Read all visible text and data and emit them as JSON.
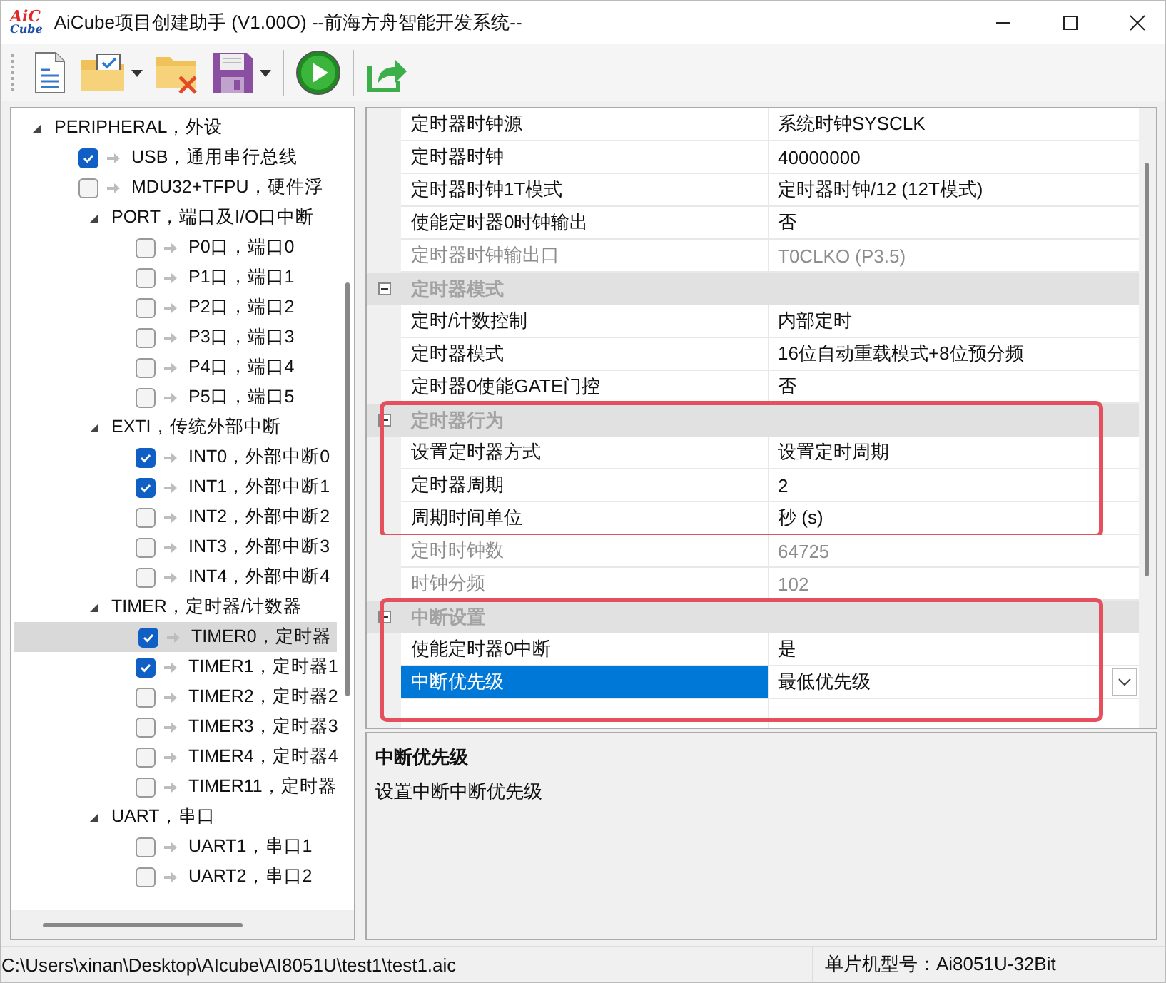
{
  "window": {
    "logo": {
      "top": "AiC",
      "bottom": "Cube"
    },
    "title": "AiCube项目创建助手 (V1.00O) --前海方舟智能开发系统--"
  },
  "tree": {
    "kind": "group",
    "label": "PERIPHERAL，外设",
    "expanded": true,
    "children": [
      {
        "kind": "item",
        "label": "USB，通用串行总线",
        "checked": true,
        "selected": false
      },
      {
        "kind": "item",
        "label": "MDU32+TFPU，硬件浮",
        "checked": false,
        "selected": false
      },
      {
        "kind": "group",
        "label": "PORT，端口及I/O口中断",
        "expanded": true,
        "children": [
          {
            "kind": "item",
            "label": "P0口，端口0",
            "checked": false,
            "selected": false
          },
          {
            "kind": "item",
            "label": "P1口，端口1",
            "checked": false,
            "selected": false
          },
          {
            "kind": "item",
            "label": "P2口，端口2",
            "checked": false,
            "selected": false
          },
          {
            "kind": "item",
            "label": "P3口，端口3",
            "checked": false,
            "selected": false
          },
          {
            "kind": "item",
            "label": "P4口，端口4",
            "checked": false,
            "selected": false
          },
          {
            "kind": "item",
            "label": "P5口，端口5",
            "checked": false,
            "selected": false
          }
        ]
      },
      {
        "kind": "group",
        "label": "EXTI，传统外部中断",
        "expanded": true,
        "children": [
          {
            "kind": "item",
            "label": "INT0，外部中断0",
            "checked": true,
            "selected": false
          },
          {
            "kind": "item",
            "label": "INT1，外部中断1",
            "checked": true,
            "selected": false
          },
          {
            "kind": "item",
            "label": "INT2，外部中断2",
            "checked": false,
            "selected": false
          },
          {
            "kind": "item",
            "label": "INT3，外部中断3",
            "checked": false,
            "selected": false
          },
          {
            "kind": "item",
            "label": "INT4，外部中断4",
            "checked": false,
            "selected": false
          }
        ]
      },
      {
        "kind": "group",
        "label": "TIMER，定时器/计数器",
        "expanded": true,
        "children": [
          {
            "kind": "item",
            "label": "TIMER0，定时器",
            "checked": true,
            "selected": true
          },
          {
            "kind": "item",
            "label": "TIMER1，定时器1",
            "checked": true,
            "selected": false
          },
          {
            "kind": "item",
            "label": "TIMER2，定时器2",
            "checked": false,
            "selected": false
          },
          {
            "kind": "item",
            "label": "TIMER3，定时器3",
            "checked": false,
            "selected": false
          },
          {
            "kind": "item",
            "label": "TIMER4，定时器4",
            "checked": false,
            "selected": false
          },
          {
            "kind": "item",
            "label": "TIMER11，定时器",
            "checked": false,
            "selected": false
          }
        ]
      },
      {
        "kind": "group",
        "label": "UART，串口",
        "expanded": true,
        "children": [
          {
            "kind": "item",
            "label": "UART1，串口1",
            "checked": false,
            "selected": false
          },
          {
            "kind": "item",
            "label": "UART2，串口2",
            "checked": false,
            "selected": false
          }
        ]
      }
    ]
  },
  "property_grid": {
    "sections": [
      {
        "highlighted": false,
        "items": [
          {
            "kind": "property",
            "label": "定时器时钟源",
            "value": "系统时钟SYSCLK",
            "disabled": false,
            "selected": false
          },
          {
            "kind": "property",
            "label": "定时器时钟",
            "value": "40000000",
            "disabled": false,
            "selected": false
          },
          {
            "kind": "property",
            "label": "定时器时钟1T模式",
            "value": "定时器时钟/12 (12T模式)",
            "disabled": false,
            "selected": false
          },
          {
            "kind": "property",
            "label": "使能定时器0时钟输出",
            "value": "否",
            "disabled": false,
            "selected": false
          },
          {
            "kind": "property",
            "label": "定时器时钟输出口",
            "value": "T0CLKO (P3.5)",
            "disabled": true,
            "selected": false
          },
          {
            "kind": "category",
            "label": "定时器模式",
            "expanded": true
          },
          {
            "kind": "property",
            "label": "定时/计数控制",
            "value": "内部定时",
            "disabled": false,
            "selected": false
          },
          {
            "kind": "property",
            "label": "定时器模式",
            "value": "16位自动重载模式+8位预分频",
            "disabled": false,
            "selected": false
          },
          {
            "kind": "property",
            "label": "定时器0使能GATE门控",
            "value": "否",
            "disabled": false,
            "selected": false
          }
        ]
      },
      {
        "highlighted": true,
        "items": [
          {
            "kind": "category",
            "label": "定时器行为",
            "expanded": true
          },
          {
            "kind": "property",
            "label": "设置定时器方式",
            "value": "设置定时周期",
            "disabled": false,
            "selected": false
          },
          {
            "kind": "property",
            "label": "定时器周期",
            "value": "2",
            "disabled": false,
            "selected": false
          },
          {
            "kind": "property",
            "label": "周期时间单位",
            "value": "秒 (s)",
            "disabled": false,
            "selected": false
          }
        ]
      },
      {
        "highlighted": false,
        "items": [
          {
            "kind": "property",
            "label": "定时时钟数",
            "value": "64725",
            "disabled": true,
            "selected": false
          },
          {
            "kind": "property",
            "label": "时钟分频",
            "value": "102",
            "disabled": true,
            "selected": false
          }
        ]
      },
      {
        "highlighted": true,
        "items": [
          {
            "kind": "category",
            "label": "中断设置",
            "expanded": true
          },
          {
            "kind": "property",
            "label": "使能定时器0中断",
            "value": "是",
            "disabled": false,
            "selected": false
          },
          {
            "kind": "property",
            "label": "中断优先级",
            "value": "最低优先级",
            "disabled": false,
            "selected": true
          }
        ]
      }
    ],
    "description": {
      "title": "中断优先级",
      "text": "设置中断中断优先级"
    }
  },
  "status_bar": {
    "path": "C:\\Users\\xinan\\Desktop\\AIcube\\AI8051U\\test1\\test1.aic",
    "chip": "单片机型号：Ai8051U-32Bit"
  }
}
